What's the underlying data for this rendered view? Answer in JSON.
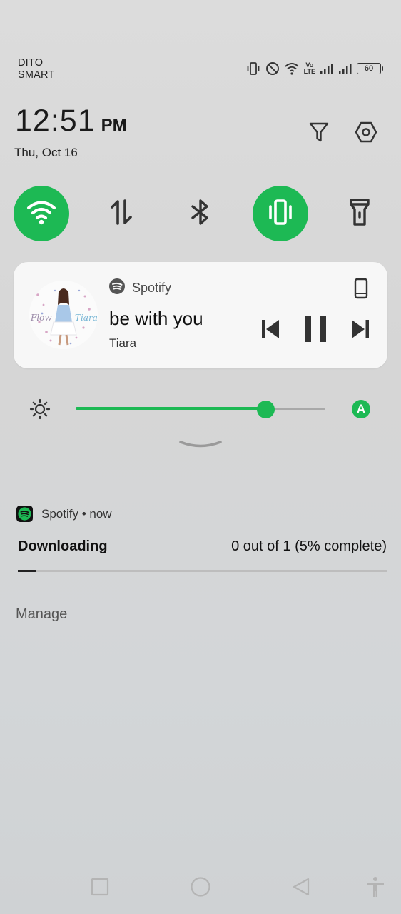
{
  "status_bar": {
    "carrier_line1": "DITO",
    "carrier_line2": "SMART",
    "network_label_top": "Vo",
    "network_label_bottom": "LTE",
    "battery": "60",
    "icons": [
      "vibrate-icon",
      "do-not-disturb-icon",
      "wifi-icon",
      "volte-icon",
      "signal-icon",
      "signal-icon",
      "battery-icon"
    ]
  },
  "header": {
    "time": "12:51",
    "ampm": "PM",
    "date": "Thu, Oct 16",
    "actions": [
      "filter-icon",
      "settings-icon"
    ]
  },
  "quick_tiles": [
    {
      "name": "wifi",
      "icon": "wifi-icon",
      "active": true
    },
    {
      "name": "mobile-data",
      "icon": "data-transfer-icon",
      "active": false
    },
    {
      "name": "bluetooth",
      "icon": "bluetooth-icon",
      "active": false
    },
    {
      "name": "vibrate",
      "icon": "vibrate-icon",
      "active": true
    },
    {
      "name": "flashlight",
      "icon": "flashlight-icon",
      "active": false
    }
  ],
  "media": {
    "app_name": "Spotify",
    "song_title": "be with you",
    "artist": "Tiara",
    "album_text_left": "Flow",
    "album_text_right": "Tiara",
    "controls": [
      "previous-icon",
      "pause-icon",
      "next-icon"
    ]
  },
  "brightness": {
    "level": 0.76,
    "auto_label": "A"
  },
  "notification": {
    "app_name": "Spotify",
    "time": "now",
    "header_text": "Spotify • now",
    "title": "Downloading",
    "status": "0 out of 1 (5% complete)",
    "progress": 0.05,
    "manage_label": "Manage"
  },
  "nav_bar": [
    "recents-icon",
    "home-icon",
    "back-icon",
    "accessibility-icon"
  ],
  "colors": {
    "accent": "#1db954",
    "background": "#d8d8d8"
  }
}
